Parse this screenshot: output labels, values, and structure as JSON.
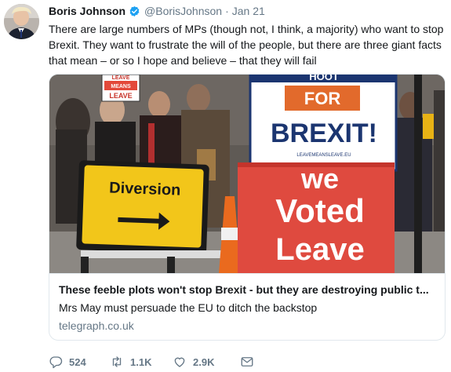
{
  "tweet": {
    "author_name": "Boris Johnson",
    "handle": "@BorisJohnson",
    "separator": "·",
    "date": "Jan 21",
    "text": "There are large numbers of MPs (though not, I think, a majority) who want to stop Brexit. They want to frustrate the will of the people, but there are three giant facts that mean – or so I hope and believe – that they will fail"
  },
  "card": {
    "image_text": {
      "small_sign_top": "LEAVE",
      "small_sign_mid": "MEANS",
      "small_sign_bottom": "LEAVE",
      "diversion": "Diversion",
      "banner_top": "HOOT",
      "banner_for": "FOR",
      "banner_brexit": "BREXIT!",
      "banner_url": "LEAVEMEANSLEAVE.EU",
      "red_we": "we",
      "red_voted": "Voted",
      "red_leave": "Leave"
    },
    "title": "These feeble plots won't stop Brexit - but they are destroying public t...",
    "description": "Mrs May must persuade the EU to ditch the backstop",
    "domain": "telegraph.co.uk"
  },
  "actions": {
    "replies": "524",
    "retweets": "1.1K",
    "likes": "2.9K"
  },
  "colors": {
    "verified": "#1da1f2",
    "secondary_text": "#657786",
    "border": "#e1e8ed"
  }
}
